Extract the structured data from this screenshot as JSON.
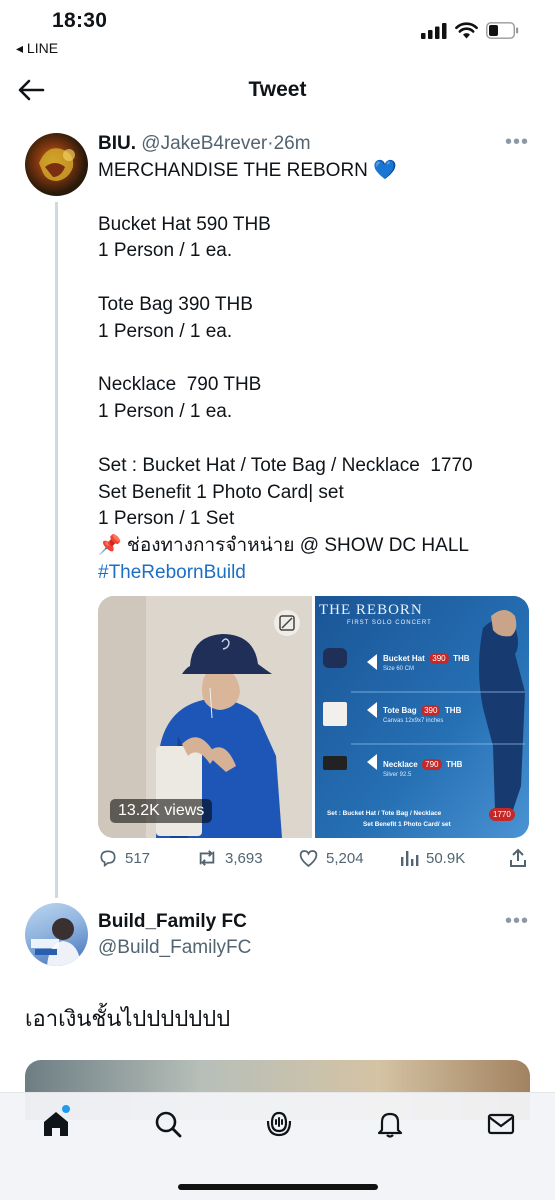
{
  "status_bar": {
    "time": "18:30",
    "back_app": "◂ LINE"
  },
  "header": {
    "title": "Tweet"
  },
  "tweet": {
    "author_name": "BIU.",
    "author_handle": "@JakeB4rever",
    "separator": "·",
    "time_ago": "26m",
    "body_lines": [
      "MERCHANDISE THE REBORN 💙",
      "",
      "Bucket Hat 590 THB",
      "1 Person / 1 ea.",
      "",
      "Tote Bag 390 THB",
      "1 Person / 1 ea.",
      "",
      "Necklace  790 THB",
      "1 Person / 1 ea.",
      "",
      "Set : Bucket Hat / Tote Bag / Necklace  1770",
      "Set Benefit 1 Photo Card| set",
      "1 Person / 1 Set",
      "📌 ช่องทางการจำหน่าย @ SHOW DC HALL"
    ],
    "hashtag": "#TheRebornBuild",
    "media": {
      "views": "13.2K views",
      "poster": {
        "title": "THE REBORN",
        "subtitle": "FIRST SOLO CONCERT",
        "items": [
          {
            "name": "Bucket Hat",
            "price": "390",
            "currency": "THB",
            "detail": "Size 60 CM"
          },
          {
            "name": "Tote Bag",
            "price": "390",
            "currency": "THB",
            "detail": "Canvas 12x9x7 inches"
          },
          {
            "name": "Necklace",
            "price": "790",
            "currency": "THB",
            "detail": "Silver 92.5"
          }
        ],
        "set_line1": "Set : Bucket Hat / Tote Bag / Necklace",
        "set_line2": "Set Benefit 1 Photo Card/ set",
        "set_price": "1770"
      }
    },
    "actions": {
      "replies": "517",
      "retweets": "3,693",
      "likes": "5,204",
      "views": "50.9K"
    }
  },
  "reply": {
    "author_name": "Build_Family FC",
    "author_handle": "@Build_FamilyFC",
    "text": "เอาเงินชั้นไปปปปปปป"
  },
  "colors": {
    "link": "#1d6fc4",
    "muted": "#536471",
    "accent": "#1d9bf0",
    "price_badge": "#c62828"
  }
}
